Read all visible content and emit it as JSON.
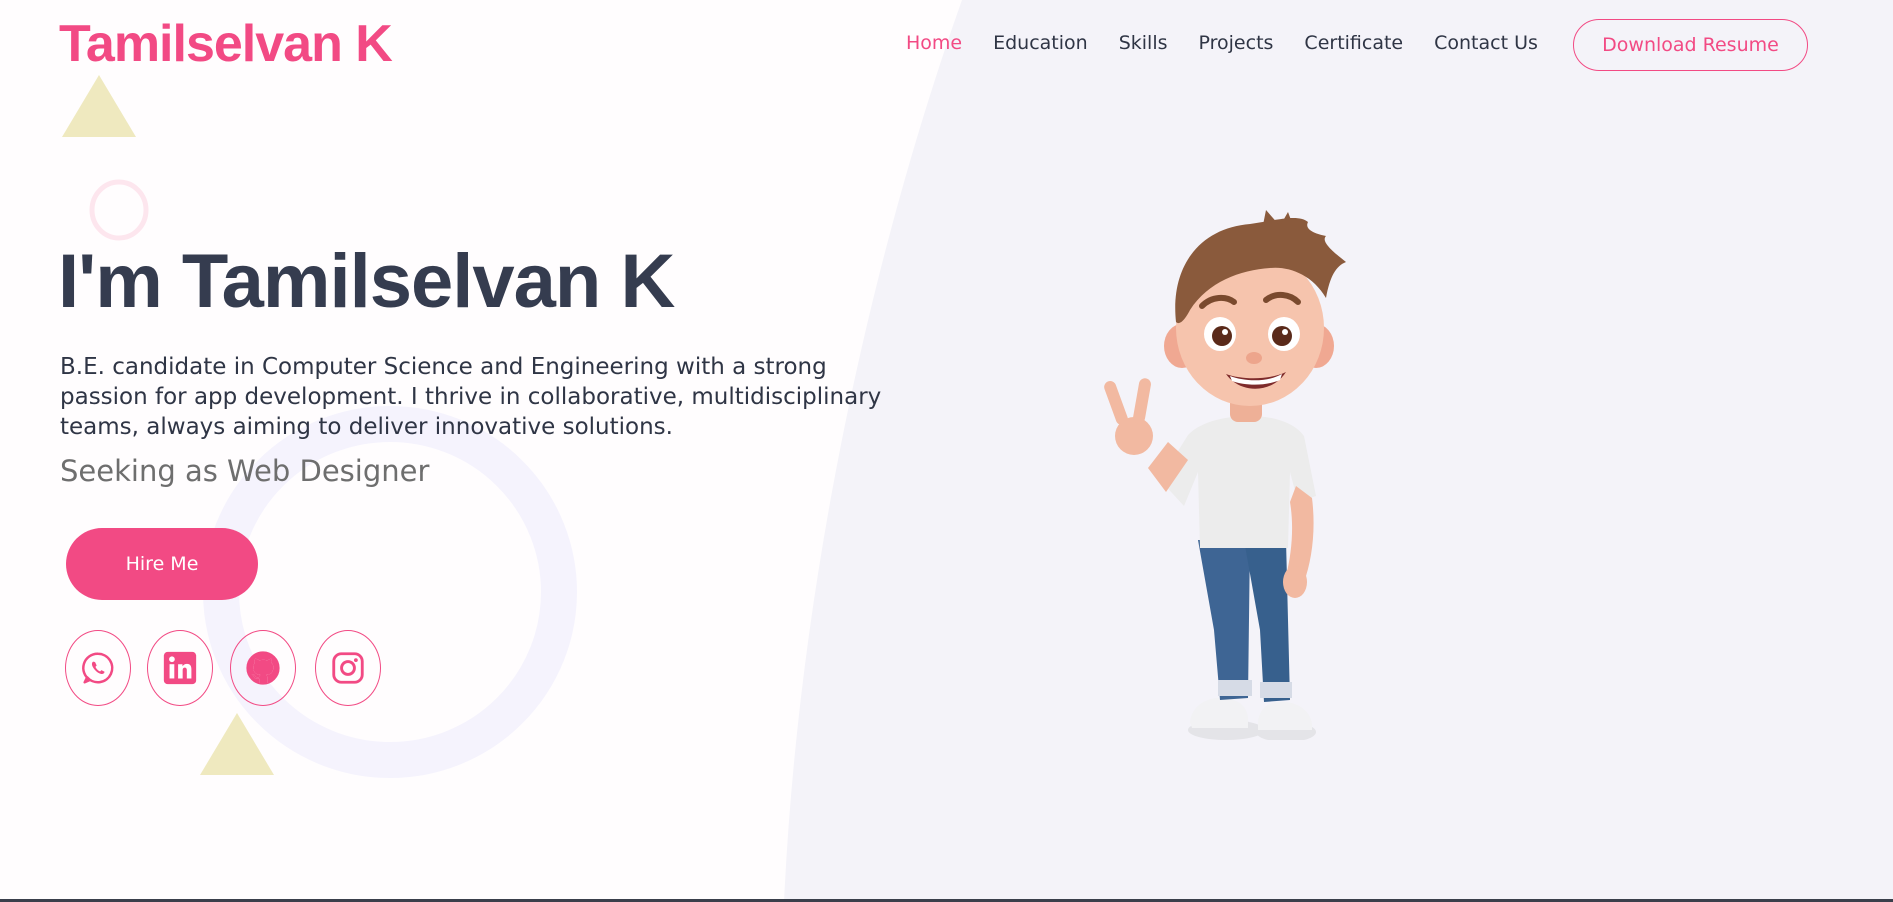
{
  "header": {
    "logo": "Tamilselvan K",
    "nav": [
      {
        "label": "Home",
        "active": true
      },
      {
        "label": "Education",
        "active": false
      },
      {
        "label": "Skills",
        "active": false
      },
      {
        "label": "Projects",
        "active": false
      },
      {
        "label": "Certificate",
        "active": false
      },
      {
        "label": "Contact Us",
        "active": false
      }
    ],
    "resume_button": "Download Resume"
  },
  "hero": {
    "title": "I'm Tamilselvan K",
    "description": "B.E. candidate in Computer Science and Engineering with a strong passion for app development. I thrive in collaborative, multidisciplinary teams, always aiming to deliver innovative solutions.",
    "subtitle": "Seeking as Web Designer",
    "hire_button": "Hire Me"
  },
  "socials": [
    {
      "icon": "whatsapp-icon"
    },
    {
      "icon": "linkedin-icon"
    },
    {
      "icon": "github-icon"
    },
    {
      "icon": "instagram-icon"
    }
  ],
  "colors": {
    "accent": "#f24a84",
    "heading": "#353c4f",
    "text": "#2f3545",
    "muted": "#6e6e6e",
    "panel": "#f4f3f9",
    "triangle": "#efe9bf"
  }
}
